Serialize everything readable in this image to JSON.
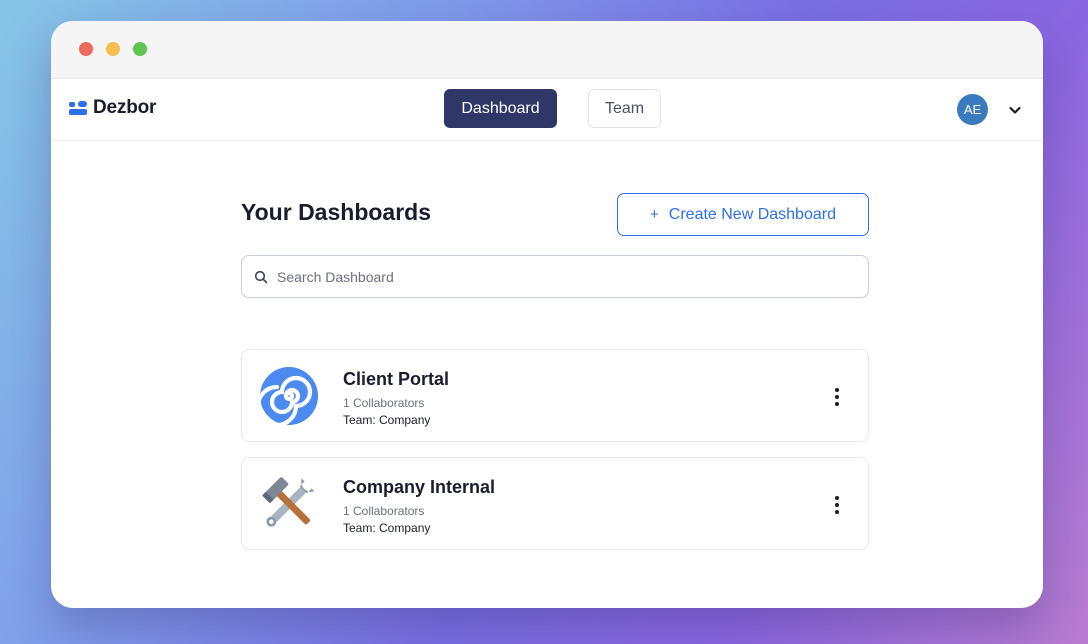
{
  "app": {
    "name": "Dezbor"
  },
  "nav": {
    "tabs": [
      {
        "label": "Dashboard",
        "active": true
      },
      {
        "label": "Team",
        "active": false
      }
    ]
  },
  "user": {
    "initials": "AE"
  },
  "main": {
    "heading": "Your Dashboards",
    "create_button_label": "Create New Dashboard",
    "search": {
      "placeholder": "Search Dashboard",
      "value": ""
    },
    "dashboards": [
      {
        "title": "Client Portal",
        "collaborators": "1 Collaborators",
        "team": "Team: Company",
        "icon": "spiral-icon"
      },
      {
        "title": "Company Internal",
        "collaborators": "1 Collaborators",
        "team": "Team: Company",
        "icon": "hammer-and-wrench-icon"
      }
    ]
  },
  "colors": {
    "accent": "#2f6fe9",
    "active_tab": "#2e3768",
    "avatar": "#3a7bbf"
  }
}
